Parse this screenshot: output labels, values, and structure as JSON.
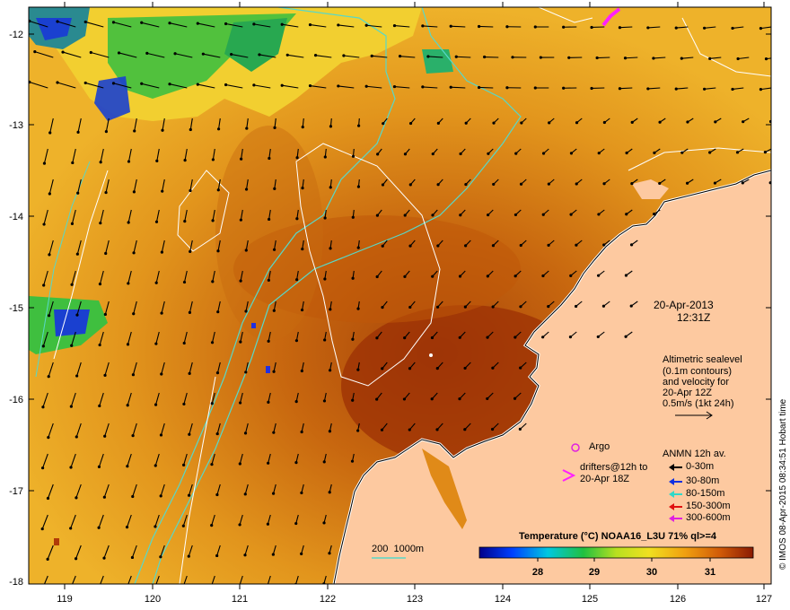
{
  "date": "20-Apr-2013",
  "time": "12:31Z",
  "altimetry_note": [
    "Altimetric sealevel",
    "(0.1m contours)",
    "and velocity for",
    "20-Apr 12Z",
    "0.5m/s (1kt 24h)"
  ],
  "argo_label": "Argo",
  "drifters_label": [
    "drifters@12h to",
    "20-Apr 18Z"
  ],
  "anmn": {
    "title": "ANMN 12h av.",
    "items": [
      {
        "label": "0-30m",
        "color": "#000000"
      },
      {
        "label": "30-80m",
        "color": "#1030e0"
      },
      {
        "label": "80-150m",
        "color": "#30d8c8"
      },
      {
        "label": "150-300m",
        "color": "#e01010"
      },
      {
        "label": "300-600m",
        "color": "#e020e0"
      }
    ]
  },
  "bathy_label": "200  1000m",
  "colorbar": {
    "title": "Temperature (°C) NOAA16_L3U 71% ql>=4",
    "ticks": [
      "28",
      "29",
      "30",
      "31"
    ]
  },
  "y_ticks": [
    "-12",
    "-13",
    "-14",
    "-15",
    "-16",
    "-17",
    "-18"
  ],
  "x_ticks": [
    "119",
    "120",
    "121",
    "122",
    "123",
    "124",
    "125",
    "126",
    "127"
  ],
  "credit": "© IMOS 08-Apr-2015 08:34:51 Hobart time",
  "colors": {
    "land": "#fdc9a0",
    "sst_warm": "#a83a06",
    "sst_mid": "#e89a14",
    "sst_cool": "#f3c430",
    "sst_green": "#3fbf3f",
    "contour_white": "#ffffff",
    "bathy_cyan": "#58d8c8"
  }
}
